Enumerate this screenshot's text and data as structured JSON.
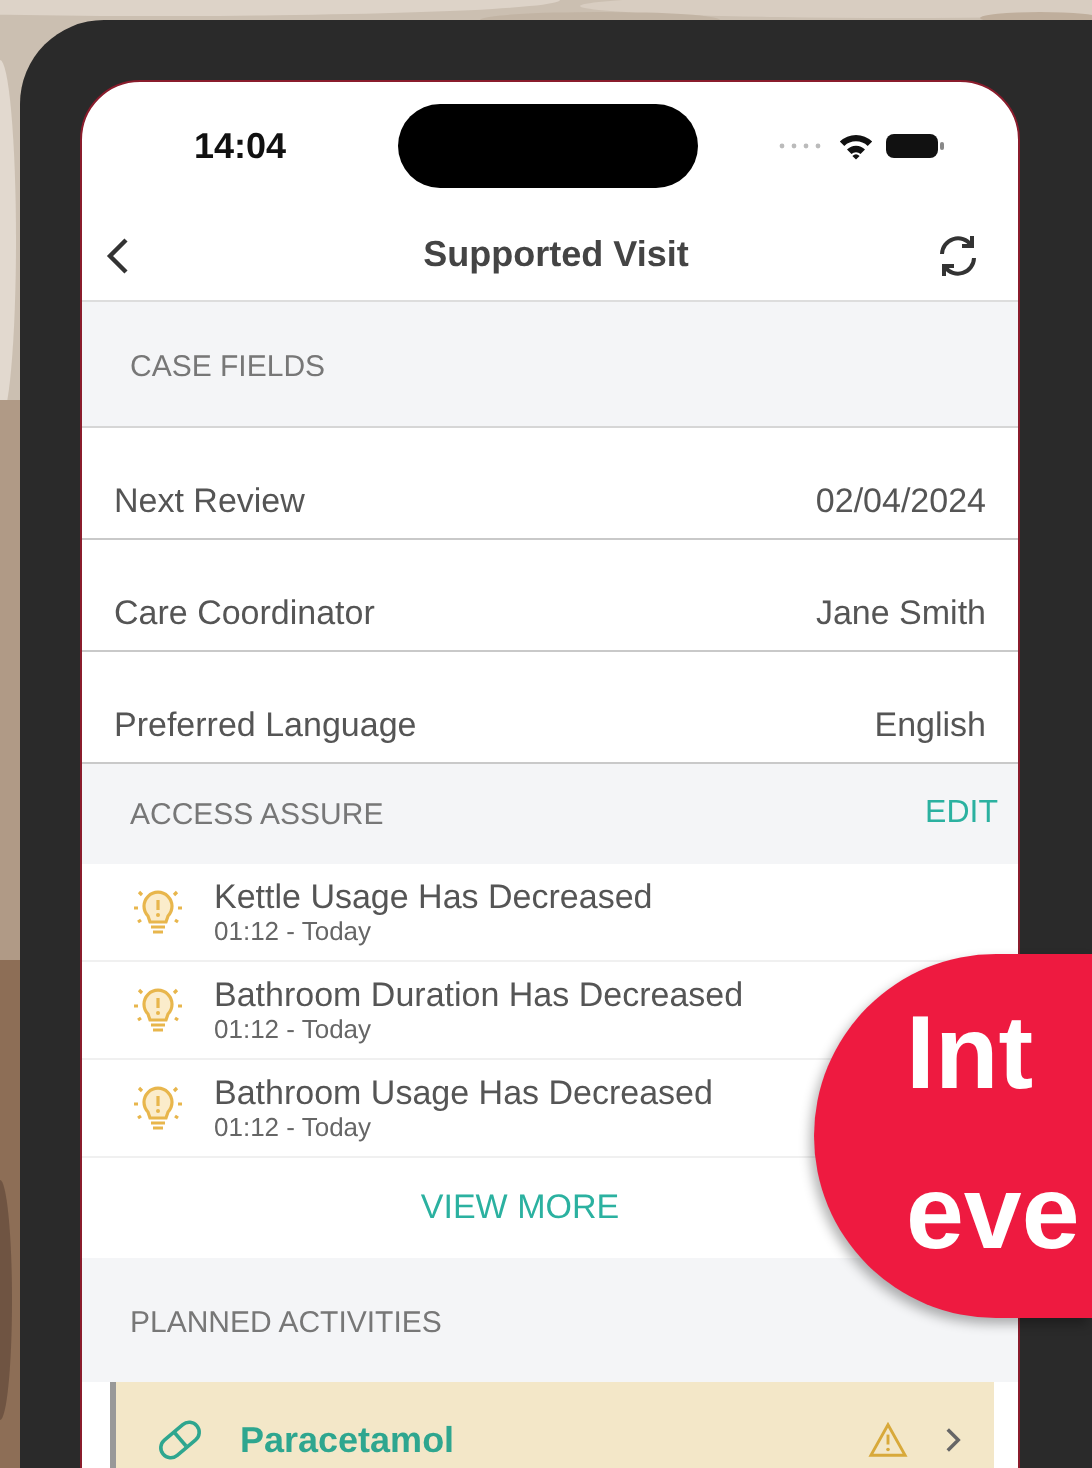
{
  "status_bar": {
    "time": "14:04"
  },
  "nav": {
    "title": "Supported Visit"
  },
  "case_fields": {
    "header": "CASE FIELDS",
    "rows": [
      {
        "label": "Next Review",
        "value": "02/04/2024"
      },
      {
        "label": "Care Coordinator",
        "value": "Jane Smith"
      },
      {
        "label": "Preferred Language",
        "value": "English"
      }
    ]
  },
  "access_assure": {
    "header": "ACCESS ASSURE",
    "action": "EDIT",
    "alerts": [
      {
        "title": "Kettle Usage Has Decreased",
        "time": "01:12 - Today"
      },
      {
        "title": "Bathroom Duration Has Decreased",
        "time": "01:12 - Today"
      },
      {
        "title": "Bathroom Usage Has Decreased",
        "time": "01:12 - Today"
      }
    ],
    "more": "VIEW MORE"
  },
  "planned_activities": {
    "header": "PLANNED ACTIVITIES",
    "items": [
      {
        "name": "Paracetamol",
        "warning": true
      }
    ]
  },
  "promo": {
    "lines": [
      "Int",
      "eve"
    ]
  }
}
